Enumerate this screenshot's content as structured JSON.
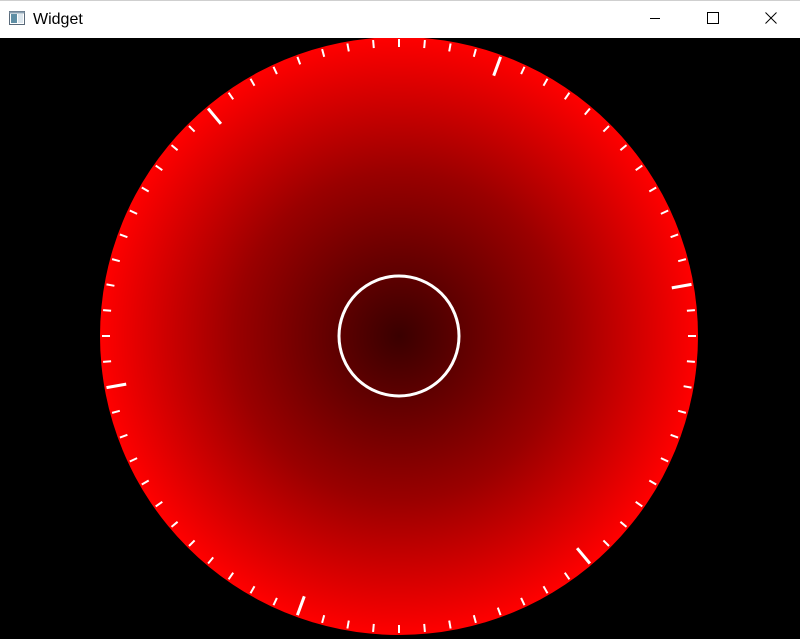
{
  "window": {
    "title": "Widget",
    "app_icon": "window-app-icon",
    "controls": {
      "minimize_icon": "minimize-icon",
      "maximize_icon": "maximize-icon",
      "close_icon": "close-icon"
    }
  },
  "canvas": {
    "background": "#000000",
    "dial": {
      "gradient_center_color": "#3a0000",
      "gradient_mid_color": "#9a0000",
      "gradient_edge_color": "#ff0000",
      "tick_color": "#ffffff",
      "inner_ring_color": "#ffffff"
    }
  }
}
